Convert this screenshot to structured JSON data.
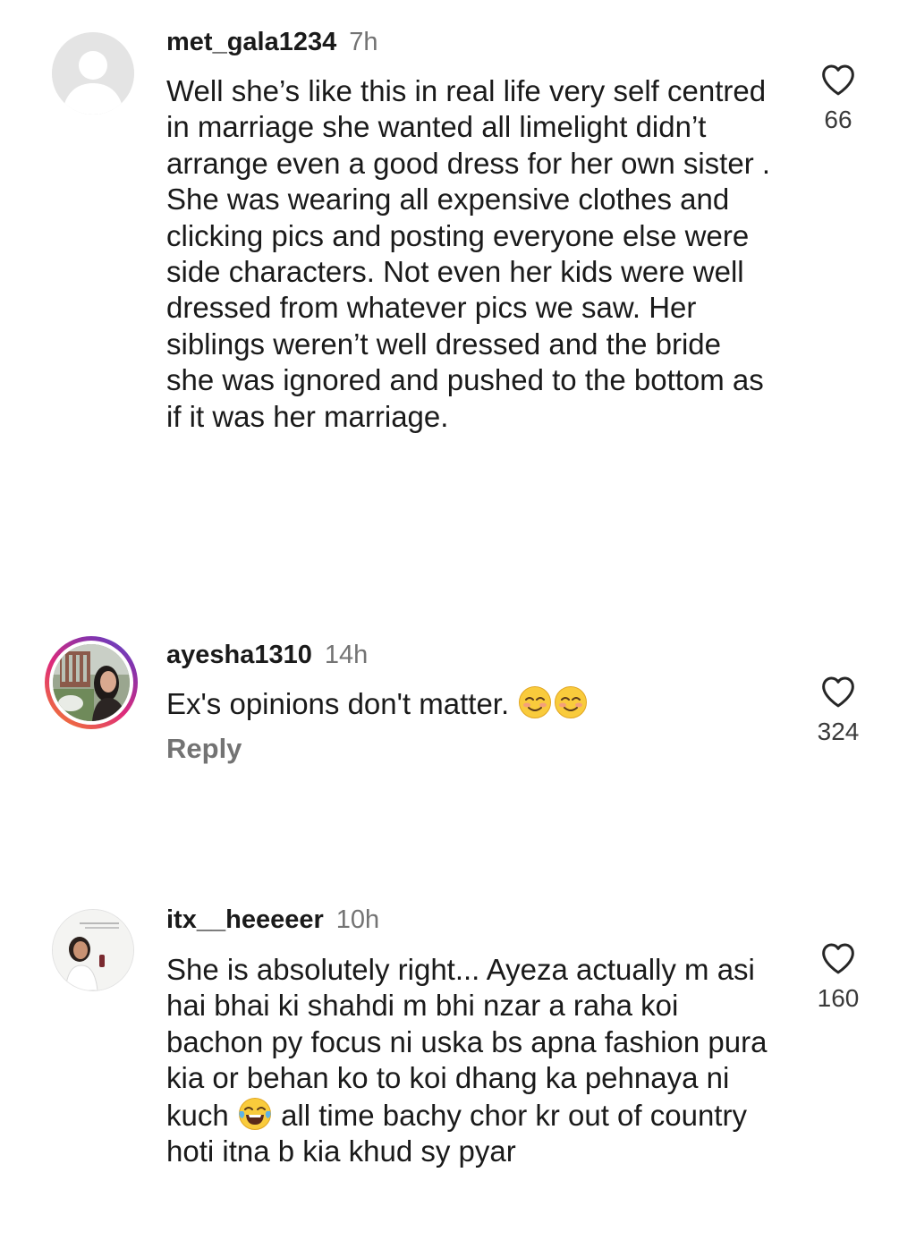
{
  "comments": [
    {
      "username": "met_gala1234",
      "time": "7h",
      "avatar_icon": "default-user-avatar-icon",
      "text": "Well she’s like this in real life very self centred in marriage she wanted all limelight didn’t arrange even a good dress for her own sister . She was wearing all expensive clothes and clicking pics and posting everyone else were side characters. Not even her kids were well dressed from whatever pics we saw. Her siblings weren’t well dressed and the bride she was ignored and pushed to the bottom as if it was her marriage.",
      "likes": "66"
    },
    {
      "username": "ayesha1310",
      "time": "14h",
      "avatar_icon": "story-ring-profile-photo",
      "text": "Ex's opinions don't matter.",
      "emojis": [
        "smiling-face-with-smiling-eyes",
        "smiling-face-with-smiling-eyes"
      ],
      "reply_label": "Reply",
      "likes": "324"
    },
    {
      "username": "itx__heeeeer",
      "time": "10h",
      "avatar_icon": "profile-photo",
      "text_before_emoji": "She is absolutely right... Ayeza actually m asi hai bhai ki shahdi m bhi nzar a raha koi bachon py focus ni uska bs apna fashion pura kia or behan ko to koi dhang ka pehnaya ni kuch",
      "emoji": "face-with-tears-of-joy",
      "text_after_emoji": "all time bachy chor kr out of country hoti itna b kia khud sy pyar",
      "likes": "160"
    }
  ],
  "colors": {
    "text": "#1a1a1a",
    "secondary": "#737373",
    "like_outline": "#262626"
  }
}
